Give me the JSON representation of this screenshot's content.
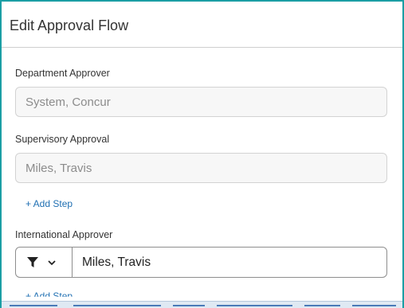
{
  "dialog": {
    "title": "Edit Approval Flow"
  },
  "steps": [
    {
      "label": "Department Approver",
      "value": "System, Concur"
    },
    {
      "label": "Supervisory Approval",
      "value": "Miles, Travis"
    }
  ],
  "add_step_label": "+ Add Step",
  "international": {
    "label": "International Approver",
    "value": "Miles, Travis",
    "filter_icon": "filter-icon",
    "dropdown_icon": "chevron-down-icon"
  },
  "cutoff_add_step": "+ Add Step",
  "colors": {
    "frame_border": "#1b9ea4",
    "link": "#1f6fb2",
    "disabled_bg": "#f7f7f7"
  }
}
